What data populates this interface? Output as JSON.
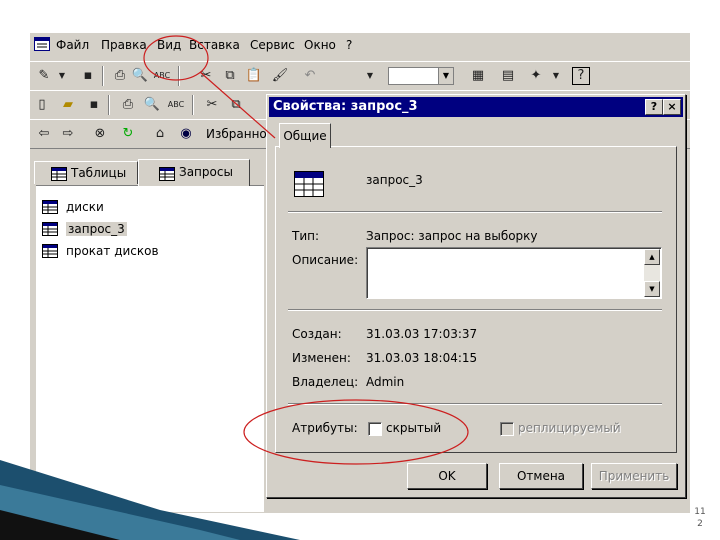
{
  "menu": {
    "items": [
      "Файл",
      "Правка",
      "Вид",
      "Вставка",
      "Сервис",
      "Окно",
      "?"
    ]
  },
  "toolbar2": {
    "favorites_label": "Избранное"
  },
  "db_tabs": {
    "tables": "Таблицы",
    "queries": "Запросы"
  },
  "query_list": [
    "диски",
    "запрос_3",
    "прокат дисков"
  ],
  "dialog": {
    "title": "Свойства: запрос_3",
    "help_button": "?",
    "close_button": "×",
    "tab_general": "Общие",
    "object_name": "запрос_3",
    "type_label": "Тип:",
    "type_value": "Запрос: запрос на выборку",
    "description_label": "Описание:",
    "description_value": "",
    "created_label": "Создан:",
    "created_value": "31.03.03 17:03:37",
    "modified_label": "Изменен:",
    "modified_value": "31.03.03 18:04:15",
    "owner_label": "Владелец:",
    "owner_value": "Admin",
    "attributes_label": "Атрибуты:",
    "hidden_label": "скрытый",
    "hidden_checked": false,
    "replicable_label": "реплицируемый",
    "replicable_checked": false,
    "ok_button": "OK",
    "cancel_button": "Отмена",
    "apply_button": "Применить"
  },
  "slide": {
    "page_number_line1": "11",
    "page_number_line2": "2"
  },
  "colors": {
    "title_bar": "#000080",
    "annotation_red": "#cc1f1f",
    "slide_accent": "#1c4f6e"
  }
}
